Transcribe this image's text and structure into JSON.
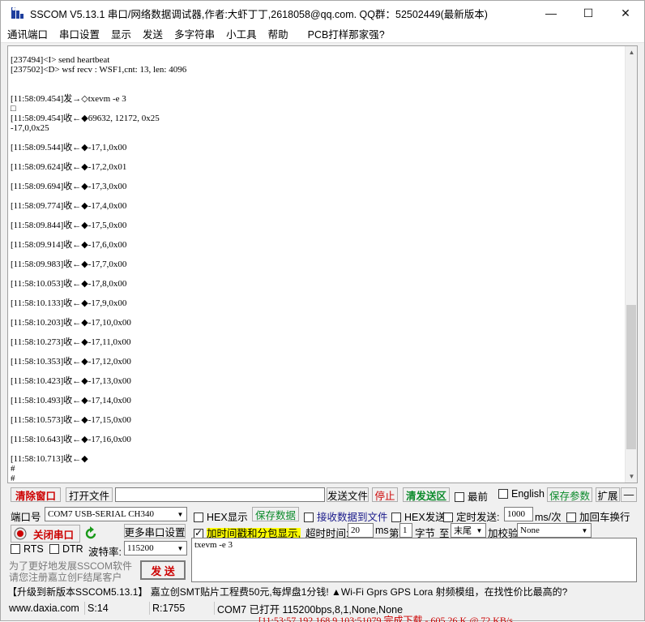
{
  "title": "SSCOM V5.13.1 串口/网络数据调试器,作者:大虾丁丁,2618058@qq.com. QQ群：52502449(最新版本)",
  "window_buttons": {
    "minimize": "—",
    "maximize": "☐",
    "close": "✕"
  },
  "menu": [
    "通讯端口",
    "串口设置",
    "显示",
    "发送",
    "多字符串",
    "小工具",
    "帮助",
    "PCB打样那家强?"
  ],
  "log_lines": [
    "[237494]<I> send heartbeat",
    "[237502]<D> wsf recv : WSF1,cnt: 13, len: 4096",
    "",
    "",
    "[11:58:09.454]发→◇txevm -e 3",
    "□",
    "[11:58:09.454]收←◆69632, 12172, 0x25",
    "-17,0,0x25",
    "",
    "[11:58:09.544]收←◆-17,1,0x00",
    "",
    "[11:58:09.624]收←◆-17,2,0x01",
    "",
    "[11:58:09.694]收←◆-17,3,0x00",
    "",
    "[11:58:09.774]收←◆-17,4,0x00",
    "",
    "[11:58:09.844]收←◆-17,5,0x00",
    "",
    "[11:58:09.914]收←◆-17,6,0x00",
    "",
    "[11:58:09.983]收←◆-17,7,0x00",
    "",
    "[11:58:10.053]收←◆-17,8,0x00",
    "",
    "[11:58:10.133]收←◆-17,9,0x00",
    "",
    "[11:58:10.203]收←◆-17,10,0x00",
    "",
    "[11:58:10.273]收←◆-17,11,0x00",
    "",
    "[11:58:10.353]收←◆-17,12,0x00",
    "",
    "[11:58:10.423]收←◆-17,13,0x00",
    "",
    "[11:58:10.493]收←◆-17,14,0x00",
    "",
    "[11:58:10.573]收←◆-17,15,0x00",
    "",
    "[11:58:10.643]收←◆-17,16,0x00",
    "",
    "[11:58:10.713]收←◆",
    "#",
    "#"
  ],
  "toolbar": {
    "clear_window": "清除窗口",
    "open_file": "打开文件",
    "file_path": "",
    "send_file": "发送文件",
    "stop": "停止",
    "clear_send": "清发送区",
    "topmost": "最前",
    "english": "English",
    "save_params": "保存参数",
    "expand": "扩展",
    "collapse": "—"
  },
  "port": {
    "label": "端口号",
    "value": "COM7 USB-SERIAL CH340",
    "close_port": "关闭串口",
    "more_settings": "更多串口设置",
    "rts": "RTS",
    "dtr": "DTR",
    "baud_label": "波特率:",
    "baud": "115200",
    "register_hint_1": "为了更好地发展SSCOM软件",
    "register_hint_2": "请您注册嘉立创F结尾客户",
    "send": "发 送"
  },
  "options": {
    "hex_display": "HEX显示",
    "save_data": "保存数据",
    "recv_to_file": "接收数据到文件",
    "hex_send": "HEX发送",
    "timed_send": "定时发送:",
    "timed_ms": "1000",
    "timed_unit": "ms/次",
    "append_crlf": "加回车换行",
    "timestamp": "加时间戳和分包显示,",
    "timeout_label": "超时时间:",
    "timeout": "20",
    "ms": "ms",
    "nth": "第",
    "byte_index": "1",
    "byte_label": "字节",
    "to": "至",
    "tail": "末尾",
    "checksum_label": "加校验",
    "checksum": "None"
  },
  "send_text": "txevm -e 3",
  "promo": "【升级到新版本SSCOM5.13.1】    嘉立创SMT贴片工程费50元,每焊盘1分钱! ▲Wi-Fi Gprs GPS Lora 射频模组，在找性价比最高的?",
  "status": {
    "site": "www.daxia.com",
    "sent": "S:14",
    "received": "R:1755",
    "port_state": "COM7 已打开  115200bps,8,1,None,None"
  },
  "bottom_bleed": "[11:53:57.192 168.9.103:51079 完成下载 - 605.26 K @ 72 KB/s"
}
